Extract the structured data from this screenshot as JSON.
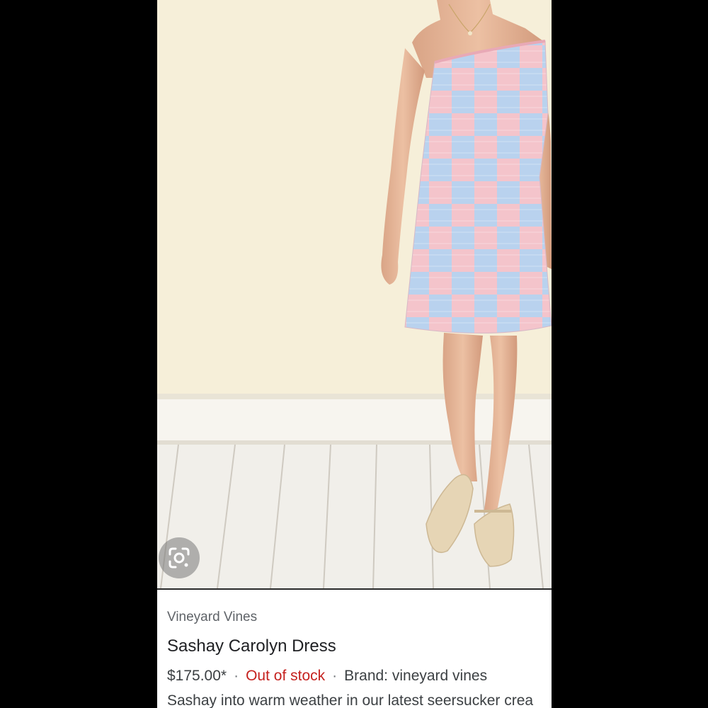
{
  "product": {
    "merchant": "Vineyard Vines",
    "title": "Sashay Carolyn Dress",
    "price": "$175.00*",
    "separator": "·",
    "stock_status": "Out of stock",
    "brand": "Brand: vineyard vines",
    "description": "Sashay into warm weather in our latest seersucker crea"
  },
  "colors": {
    "wall": "#f6efd9",
    "floor": "#f1efea",
    "dress_pink": "#f4c4cb",
    "dress_blue": "#b9d2ee",
    "out_of_stock": "#c5221f"
  },
  "icons": {
    "lens": "google-lens-icon"
  }
}
